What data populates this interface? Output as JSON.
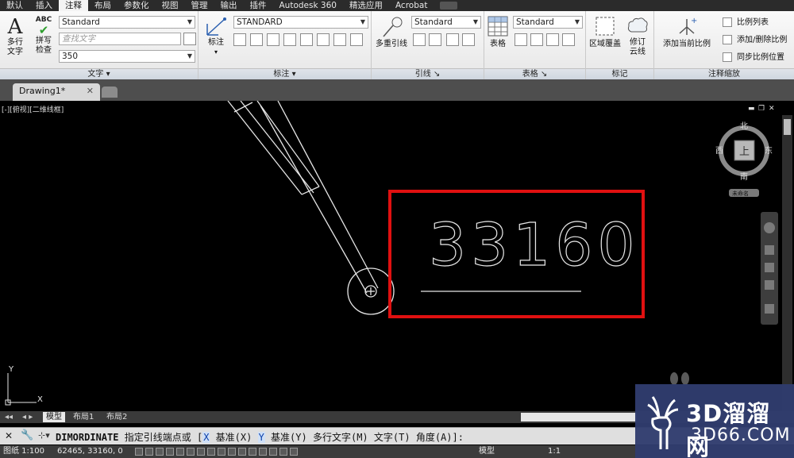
{
  "menu": [
    "默认",
    "插入",
    "注释",
    "布局",
    "参数化",
    "视图",
    "管理",
    "输出",
    "插件",
    "Autodesk 360",
    "精选应用",
    "Acrobat"
  ],
  "active_menu": "注释",
  "ribbon": {
    "text_panel": {
      "title": "文字",
      "mtext_label_1": "多行",
      "mtext_label_2": "文字",
      "spell_label_1": "拼写",
      "spell_label_2": "检查",
      "style_value": "Standard",
      "find_placeholder": "查找文字",
      "height_value": "350"
    },
    "dim_panel": {
      "title": "标注",
      "dim_label": "标注",
      "style_value": "STANDARD"
    },
    "leader_panel": {
      "title": "引线",
      "mleader_label": "多重引线",
      "style_value": "Standard"
    },
    "table_panel": {
      "title": "表格",
      "table_label": "表格",
      "style_value": "Standard"
    },
    "markup_panel": {
      "title": "标记",
      "wipeout_label": "区域覆盖",
      "revcloud_label_1": "修订",
      "revcloud_label_2": "云线"
    },
    "scale_panel": {
      "title": "注释缩放",
      "add_scale_label": "添加当前比例",
      "scale_list": "比例列表",
      "add_delete": "添加/删除比例",
      "sync": "同步比例位置"
    }
  },
  "doc_tab": "Drawing1*",
  "viewport_label": "[-][俯视][二维线框]",
  "viewcube": {
    "n": "北",
    "s": "南",
    "e": "东",
    "w": "西",
    "top": "上",
    "wcs": "未命名"
  },
  "drawing": {
    "dimension_text": "33160"
  },
  "layout_tabs": [
    "模型",
    "布局1",
    "布局2"
  ],
  "command": {
    "name": "DIMORDINATE",
    "prompt": "指定引线端点或",
    "opt1_key": "X",
    "opt1": "基准(X)",
    "opt2_key": "Y",
    "opt2": "基准(Y)",
    "opt3": "多行文字(M)",
    "opt4": "文字(T)",
    "opt5": "角度(A)"
  },
  "status": {
    "scale": "图纸 1:100",
    "coords": "62465, 33160, 0",
    "model": "模型",
    "anno_scale": "1:1"
  },
  "watermark": {
    "line1": "3D溜溜网",
    "line2": "3D66.COM"
  },
  "colors": {
    "highlight_box": "#e01010",
    "drawing_lines": "#e6e6e6"
  }
}
